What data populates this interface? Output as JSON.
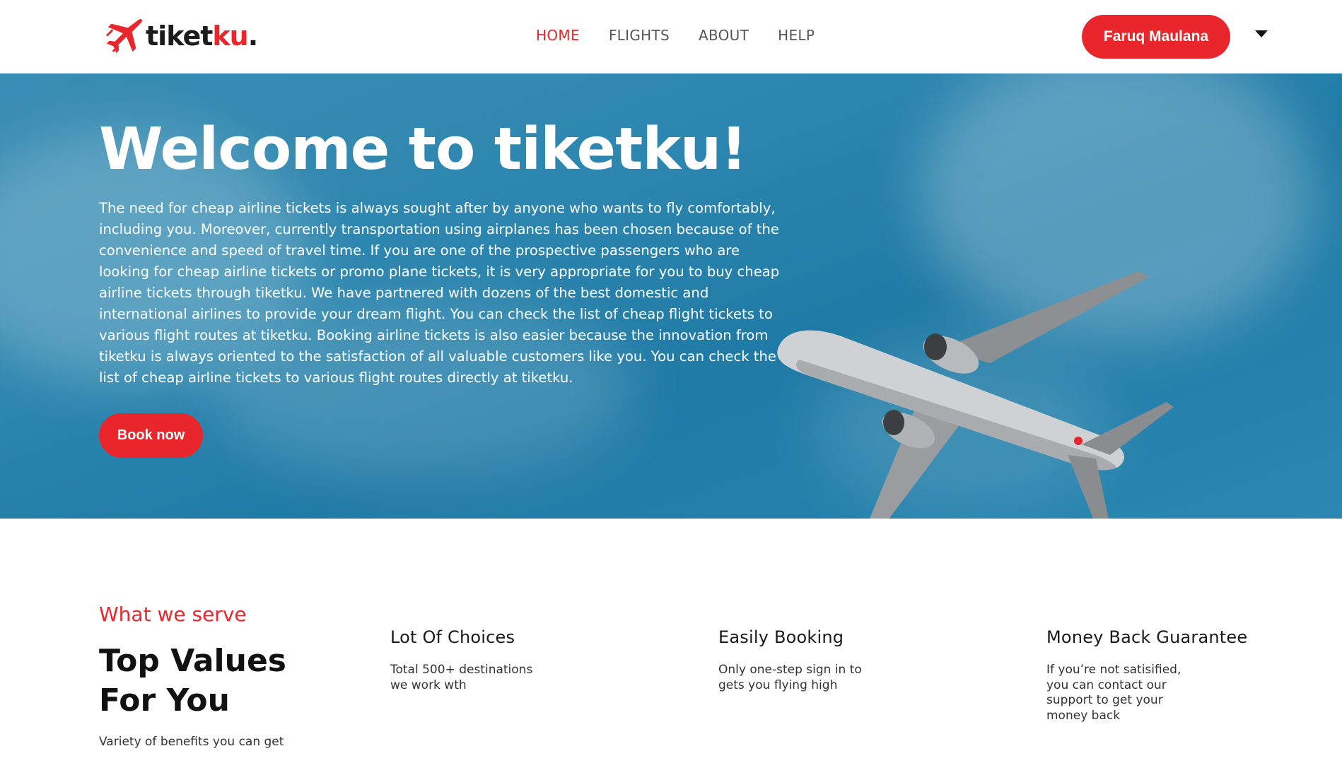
{
  "brand": {
    "name_main": "tiket",
    "name_accent": "ku",
    "name_dot": "."
  },
  "nav": {
    "links": [
      {
        "label": "HOME",
        "active": true
      },
      {
        "label": "FLIGHTS",
        "active": false
      },
      {
        "label": "ABOUT",
        "active": false
      },
      {
        "label": "HELP",
        "active": false
      }
    ],
    "user_name": "Faruq Maulana"
  },
  "hero": {
    "title": "Welcome to tiketku!",
    "description": "The need for cheap airline tickets is always sought after by anyone who wants to fly comfortably, including you. Moreover, currently transportation using airplanes has been chosen because of the convenience and speed of travel time. If you are one of the prospective passengers who are looking for cheap airline tickets or promo plane tickets, it is very appropriate for you to buy cheap airline tickets through tiketku. We have partnered with dozens of the best domestic and international airlines to provide your dream flight. You can check the list of cheap flight tickets to various flight routes at tiketku. Booking airline tickets is also easier because the innovation from tiketku is always oriented to the satisfaction of all valuable customers like you. You can check the list of cheap airline tickets to various flight routes directly at tiketku.",
    "book_label": "Book now"
  },
  "services": {
    "label": "What we serve",
    "title": "Top Values For You",
    "subtitle": "Variety of benefits you can get",
    "features": [
      {
        "title": "Lot Of Choices",
        "text": "Total 500+ destinations we work wth"
      },
      {
        "title": "Easily Booking",
        "text": "Only one-step sign in to gets you flying high"
      },
      {
        "title": "Money Back Guarantee",
        "text": "If you’re not satisified, you can contact our support to get your money back"
      }
    ]
  },
  "colors": {
    "accent": "#e8262c",
    "sky": "#2c86af",
    "text": "#1a1a1a"
  },
  "icons": {
    "logo": "airplane-logo-icon",
    "dropdown": "caret-down-icon"
  }
}
